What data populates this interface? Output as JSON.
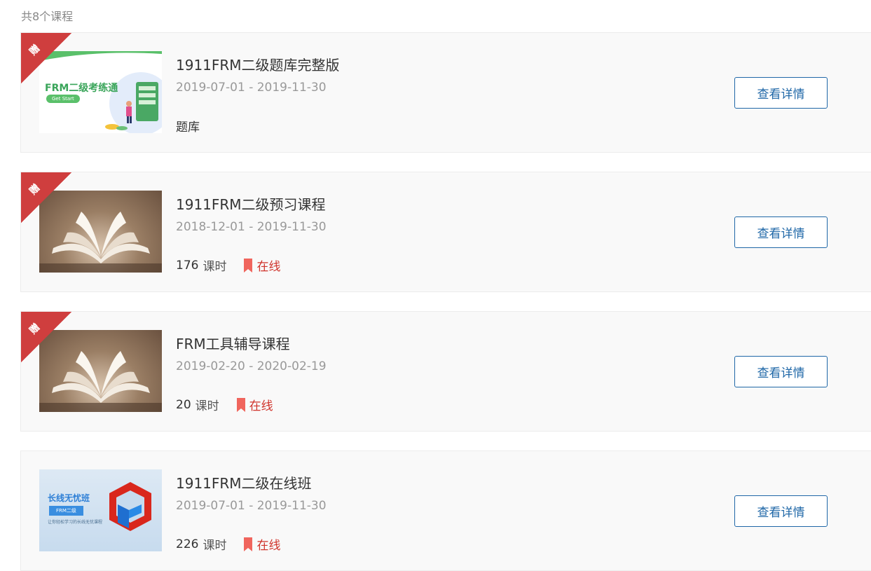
{
  "header": {
    "count_text": "共8个课程"
  },
  "ribbon_label": "赠",
  "courses": [
    {
      "title": "1911FRM二级题库完整版",
      "dates": "2019-07-01 - 2019-11-30",
      "type": "题库",
      "detail_label": "查看详情",
      "thumb": {
        "heading": "FRM二级考练通",
        "button": "Get Start"
      }
    },
    {
      "title": "1911FRM二级预习课程",
      "dates": "2018-12-01 - 2019-11-30",
      "lessons": "176",
      "lessons_unit": "课时",
      "status": "在线",
      "detail_label": "查看详情"
    },
    {
      "title": "FRM工具辅导课程",
      "dates": "2019-02-20 - 2020-02-19",
      "lessons": "20",
      "lessons_unit": "课时",
      "status": "在线",
      "detail_label": "查看详情"
    },
    {
      "title": "1911FRM二级在线班",
      "dates": "2019-07-01 - 2019-11-30",
      "lessons": "226",
      "lessons_unit": "课时",
      "status": "在线",
      "detail_label": "查看详情",
      "thumb": {
        "heading": "长线无忧班",
        "badge": "FRM二级",
        "caption": "让你轻松学习的长线无忧课程"
      }
    }
  ],
  "colors": {
    "ribbon": "#cf3e3e",
    "button_border": "#1f67a7",
    "status": "#d0342c",
    "bookmark": "#f0655d"
  },
  "icons": {
    "bookmark": "bookmark-icon"
  }
}
